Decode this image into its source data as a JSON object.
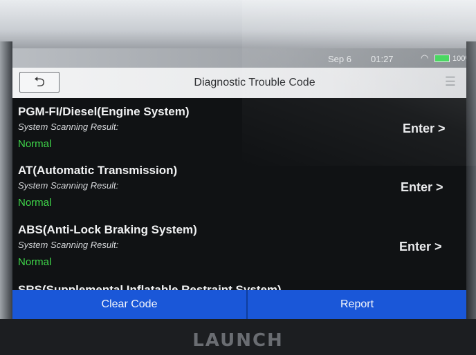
{
  "status_bar": {
    "date": "Sep 6",
    "time": "01:27",
    "battery": "100%"
  },
  "header": {
    "back_icon": "back-arrow-icon",
    "title": "Diagnostic Trouble Code",
    "menu_icon": "menu-icon"
  },
  "systems": [
    {
      "name": "PGM-FI/Diesel(Engine System)",
      "result_label": "System Scanning Result:",
      "result": "Normal",
      "enter_label": "Enter >"
    },
    {
      "name": "AT(Automatic Transmission)",
      "result_label": "System Scanning Result:",
      "result": "Normal",
      "enter_label": "Enter >"
    },
    {
      "name": "ABS(Anti-Lock Braking System)",
      "result_label": "System Scanning Result:",
      "result": "Normal",
      "enter_label": "Enter >"
    },
    {
      "name": "SRS(Supplemental Inflatable Restraint System)"
    }
  ],
  "actions": {
    "clear_code": "Clear Code",
    "report": "Report"
  },
  "device": {
    "brand": "LAUNCH"
  },
  "colors": {
    "action_bar": "#1a57d8",
    "result_normal": "#3fd64a",
    "screen_bg": "#101214"
  }
}
